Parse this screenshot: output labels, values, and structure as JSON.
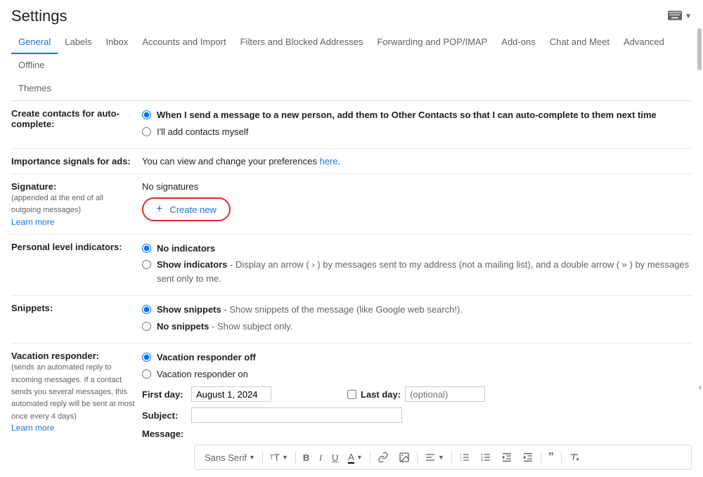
{
  "page": {
    "title": "Settings"
  },
  "tabs": {
    "general": "General",
    "labels": "Labels",
    "inbox": "Inbox",
    "accounts": "Accounts and Import",
    "filters": "Filters and Blocked Addresses",
    "forwarding": "Forwarding and POP/IMAP",
    "addons": "Add-ons",
    "chat": "Chat and Meet",
    "advanced": "Advanced",
    "offline": "Offline",
    "themes": "Themes"
  },
  "contacts": {
    "title": "Create contacts for auto-complete:",
    "opt1": "When I send a message to a new person, add them to Other Contacts so that I can auto-complete to them next time",
    "opt2": "I'll add contacts myself"
  },
  "ads": {
    "title": "Importance signals for ads:",
    "text": "You can view and change your preferences ",
    "link": "here",
    "dot": "."
  },
  "signature": {
    "title": "Signature:",
    "sub": "(appended at the end of all outgoing messages)",
    "learn": "Learn more",
    "status": "No signatures",
    "create": "Create new"
  },
  "indicators": {
    "title": "Personal level indicators:",
    "opt1": "No indicators",
    "opt2a": "Show indicators",
    "opt2b": " - Display an arrow ( › ) by messages sent to my address (not a mailing list), and a double arrow ( » ) by messages sent only to me."
  },
  "snippets": {
    "title": "Snippets:",
    "opt1a": "Show snippets",
    "opt1b": " - Show snippets of the message (like Google web search!).",
    "opt2a": "No snippets",
    "opt2b": " - Show subject only."
  },
  "vacation": {
    "title": "Vacation responder:",
    "sub": "(sends an automated reply to incoming messages. If a contact sends you several messages, this automated reply will be sent at most once every 4 days)",
    "learn": "Learn more",
    "off": "Vacation responder off",
    "on": "Vacation responder on",
    "firstday_label": "First day:",
    "firstday_value": "August 1, 2024",
    "lastday_label": "Last day:",
    "lastday_placeholder": "(optional)",
    "subject_label": "Subject:",
    "message_label": "Message:"
  },
  "toolbar": {
    "font": "Sans Serif"
  }
}
